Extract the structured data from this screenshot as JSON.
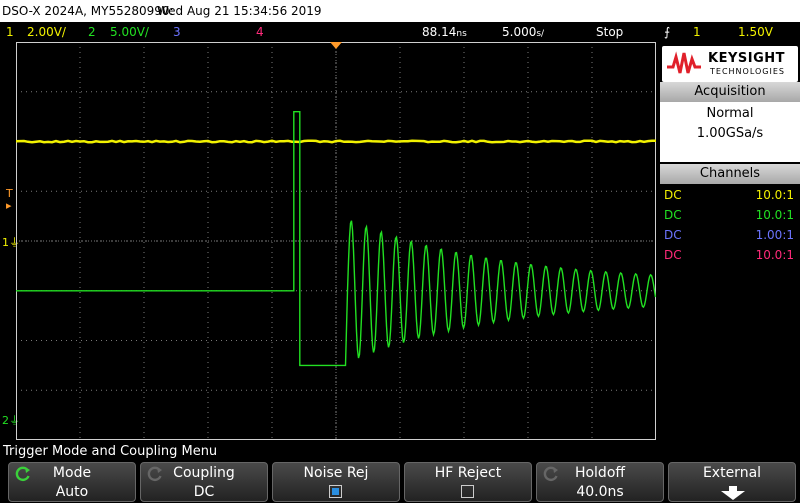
{
  "header": {
    "model": "DSO-X 2024A, MY55280990:",
    "datetime": "Wed Aug 21 15:34:56 2019"
  },
  "channel_bar": {
    "ch1_num": "1",
    "ch1_scale": "2.00V/",
    "ch2_num": "2",
    "ch2_scale": "5.00V/",
    "ch3_num": "3",
    "ch4_num": "4",
    "delay": "88.14",
    "delay_unit": "ns",
    "timebase": "5.000",
    "timebase_unit": "s/",
    "run_state": "Stop",
    "trigger_source": "1",
    "trigger_level": "1.50V"
  },
  "markers": {
    "trigger_mark": "T",
    "ch1_marker": "1",
    "ch2_marker": "2"
  },
  "logo": {
    "line1": "KEYSIGHT",
    "line2": "TECHNOLOGIES"
  },
  "acquisition": {
    "title": "Acquisition",
    "mode": "Normal",
    "rate": "1.00GSa/s"
  },
  "channels": {
    "title": "Channels",
    "rows": [
      {
        "coupling": "DC",
        "probe": "10.0:1"
      },
      {
        "coupling": "DC",
        "probe": "10.0:1"
      },
      {
        "coupling": "DC",
        "probe": "1.00:1"
      },
      {
        "coupling": "DC",
        "probe": "10.0:1"
      }
    ]
  },
  "menu": {
    "title": "Trigger Mode and Coupling Menu",
    "softkeys": [
      {
        "label": "Mode",
        "value": "Auto"
      },
      {
        "label": "Coupling",
        "value": "DC"
      },
      {
        "label": "Noise Rej",
        "value": ""
      },
      {
        "label": "HF Reject",
        "value": ""
      },
      {
        "label": "Holdoff",
        "value": "40.0ns"
      },
      {
        "label": "External",
        "value": ""
      }
    ]
  },
  "colors": {
    "ch1": "#f2f200",
    "ch2": "#22e022",
    "ch3": "#6c74ff",
    "ch4": "#ff2a7a",
    "trigger_mark": "#ff9a2a",
    "grid": "#7a7a7a",
    "grid_border": "#cfcfcf"
  },
  "waveforms": {
    "ch1_level_div": 2.0,
    "ch2_low_level_div": -1.0,
    "ch2_pulse_start_ns": -3.3,
    "ch2_pulse_high_div": 2.6,
    "ch2_dip_div": -2.5,
    "ch2_ring_start_ns": 0.9,
    "ch2_ring_center_div": -1.0,
    "ch2_ring_amplitude_div": 1.3,
    "ch2_ring_period_ns": 0.45
  }
}
